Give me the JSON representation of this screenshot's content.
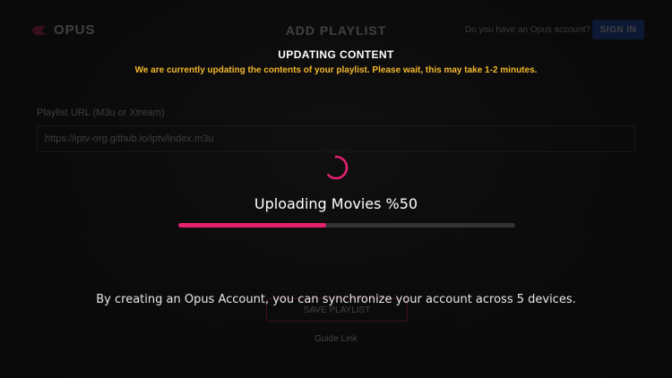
{
  "background_screen": {
    "logo_text": "OPUS",
    "page_title": "ADD PLAYLIST",
    "account_question": "Do you have an Opus account?",
    "sign_in_label": "SIGN IN",
    "url_label": "Playlist URL (M3u or Xtream)",
    "url_value": "https://iptv-org.github.io/iptv/index.m3u",
    "primary_button_label": "SAVE PLAYLIST",
    "secondary_link_label": "Guide Link"
  },
  "overlay": {
    "title": "UPDATING CONTENT",
    "message": "We are currently updating the contents of your playlist. Please wait, this may take 1-2 minutes.",
    "progress_label": "Uploading Movies %50",
    "progress_value": 0.44,
    "footer_text": "By creating an Opus Account, you can synchronize your account across 5 devices."
  },
  "colors": {
    "accent": "#e5216f",
    "warning_text": "#f4b82e",
    "sign_in_button": "#1d4fd1",
    "track": "#333333"
  },
  "icons": {
    "logo": "opus-logo-icon",
    "spinner": "loading-spinner-icon"
  }
}
